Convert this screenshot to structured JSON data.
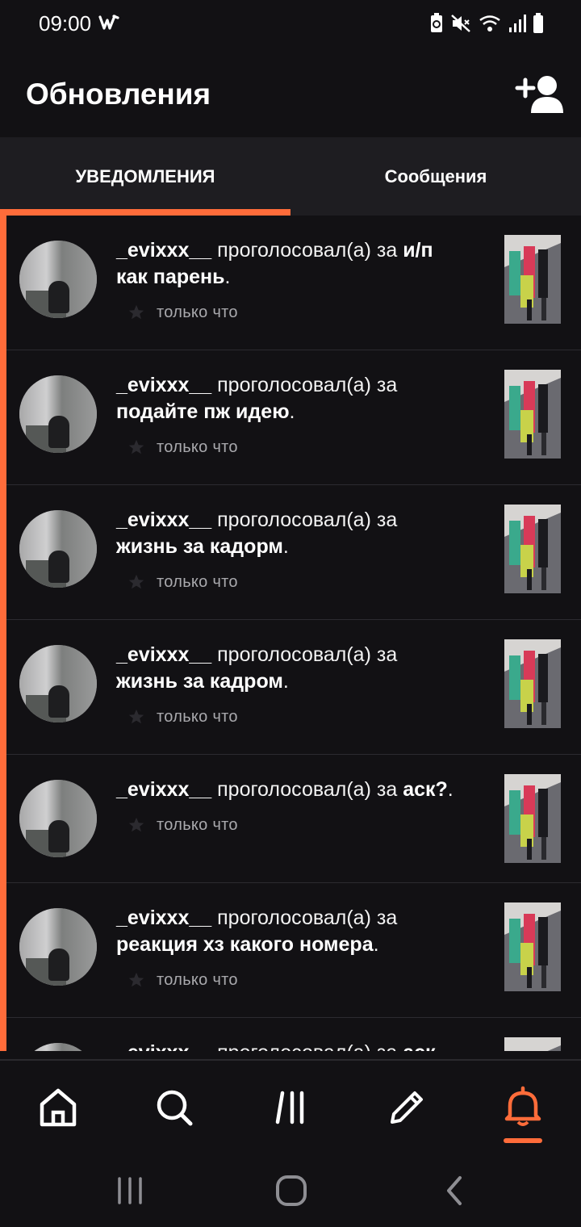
{
  "status": {
    "time": "09:00"
  },
  "header": {
    "title": "Обновления",
    "add_user_icon": "add-user-icon"
  },
  "tabs": [
    {
      "label": "УВЕДОМЛЕНИЯ",
      "active": true
    },
    {
      "label": "Сообщения",
      "active": false
    }
  ],
  "notifications": [
    {
      "user": "_evixxx__",
      "action": "проголосовал(а) за",
      "line1_story": "и/п",
      "line2_story": "как парень",
      "time": "только что"
    },
    {
      "user": "_evixxx__",
      "action": "проголосовал(а) за",
      "line1_story": "",
      "line2_story": "подайте пж идею",
      "time": "только что"
    },
    {
      "user": "_evixxx__",
      "action": "проголосовал(а) за",
      "line1_story": "",
      "line2_story": "жизнь за кадорм",
      "time": "только что"
    },
    {
      "user": "_evixxx__",
      "action": "проголосовал(а) за",
      "line1_story": "",
      "line2_story": "жизнь за кадром",
      "time": "только что"
    },
    {
      "user": "_evixxx__",
      "action": "проголосовал(а) за",
      "line1_story": "аск?",
      "line2_story": "",
      "time": "только что"
    },
    {
      "user": "_evixxx__",
      "action": "проголосовал(а) за",
      "line1_story": "",
      "line2_story": "реакция хз какого номера",
      "time": "только что"
    },
    {
      "user": "_evixxx__",
      "action": "проголосовал(а) за",
      "line1_story": "аск",
      "line2_story": "",
      "time": ""
    }
  ],
  "bottom_nav": [
    "home-icon",
    "search-icon",
    "library-icon",
    "write-icon",
    "bell-icon"
  ],
  "colors": {
    "accent": "#ff6c3a",
    "background": "#121114",
    "tab_bar": "#1e1d21"
  }
}
